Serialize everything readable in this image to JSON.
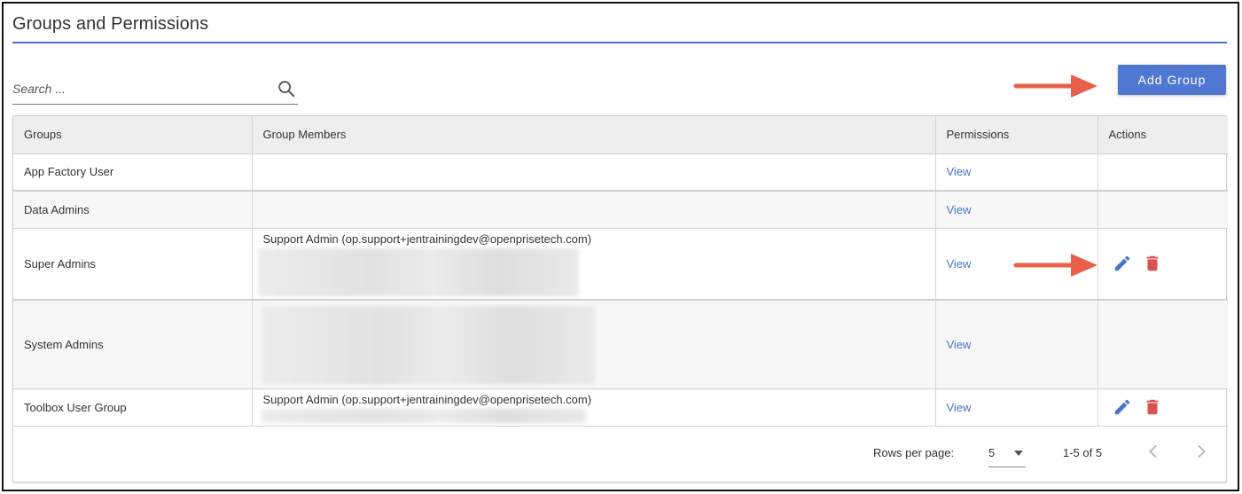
{
  "page": {
    "title": "Groups and Permissions"
  },
  "search": {
    "placeholder": "Search ..."
  },
  "toolbar": {
    "add_group_label": "Add Group"
  },
  "table": {
    "headers": [
      "Groups",
      "Group Members",
      "Permissions",
      "Actions"
    ],
    "rows": [
      {
        "group": "App Factory User",
        "members": "",
        "permissions": "View"
      },
      {
        "group": "Data Admins",
        "members": "",
        "permissions": "View"
      },
      {
        "group": "Super Admins",
        "members": "Support Admin (op.support+jentrainingdev@openprisetech.com)",
        "permissions": "View"
      },
      {
        "group": "System Admins",
        "members": "",
        "permissions": "View"
      },
      {
        "group": "Toolbox User Group",
        "members": "Support Admin (op.support+jentrainingdev@openprisetech.com)",
        "permissions": "View"
      }
    ]
  },
  "pagination": {
    "rows_per_page_label": "Rows per page:",
    "rows_per_page_value": "5",
    "range": "1-5 of 5"
  },
  "icons": {
    "search": "search-icon",
    "edit": "pencil-icon",
    "delete": "trash-icon",
    "prev": "chevron-left-icon",
    "next": "chevron-right-icon",
    "dropdown": "caret-down-icon",
    "annotation": "arrow-annotation-icon"
  },
  "colors": {
    "accent": "#5078d2",
    "link": "#4a72c9",
    "delete": "#d9534f",
    "annotation_arrow": "#e8604a"
  }
}
